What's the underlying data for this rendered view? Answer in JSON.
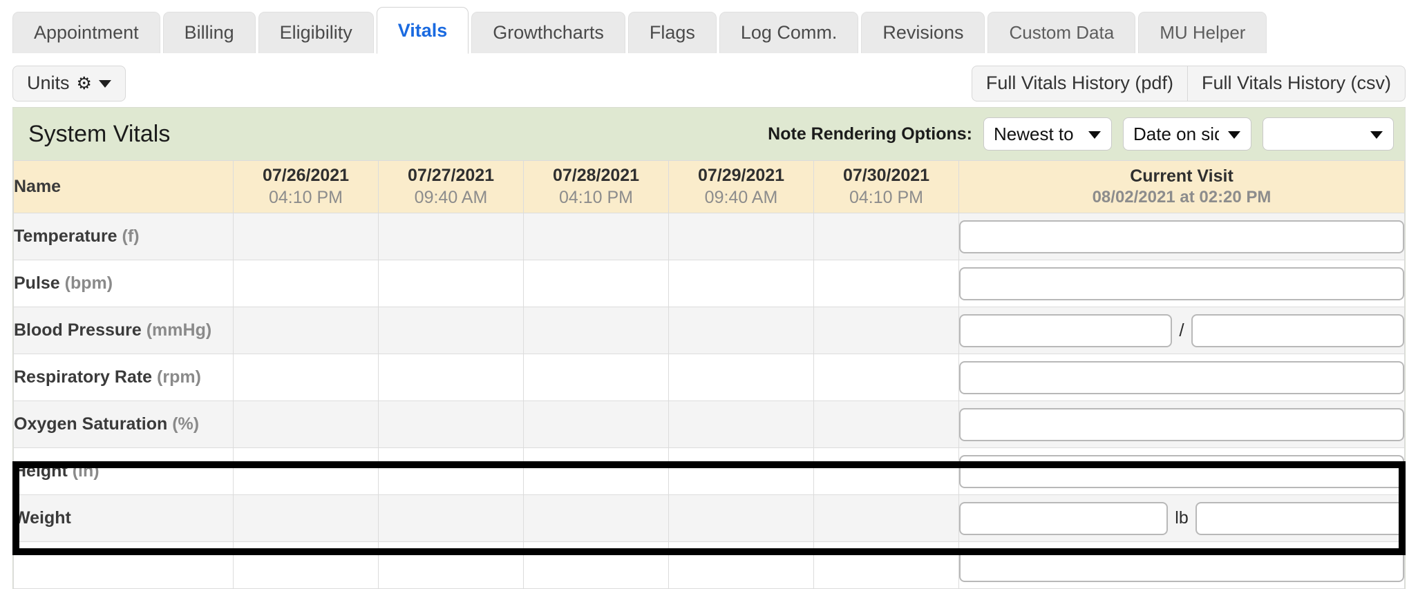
{
  "tabs": [
    {
      "label": "Appointment",
      "active": false,
      "muted": false
    },
    {
      "label": "Billing",
      "active": false,
      "muted": false
    },
    {
      "label": "Eligibility",
      "active": false,
      "muted": false
    },
    {
      "label": "Vitals",
      "active": true,
      "muted": false
    },
    {
      "label": "Growthcharts",
      "active": false,
      "muted": false
    },
    {
      "label": "Flags",
      "active": false,
      "muted": false
    },
    {
      "label": "Log Comm.",
      "active": false,
      "muted": false
    },
    {
      "label": "Revisions",
      "active": false,
      "muted": false
    },
    {
      "label": "Custom Data",
      "active": false,
      "muted": true
    },
    {
      "label": "MU Helper",
      "active": false,
      "muted": true
    }
  ],
  "toolbar": {
    "units_label": "Units",
    "gear_icon": "gear-icon",
    "caret_icon": "caret-down-icon",
    "history_pdf": "Full Vitals History (pdf)",
    "history_csv": "Full Vitals History (csv)"
  },
  "panel": {
    "title": "System Vitals",
    "note_options_label": "Note Rendering Options:",
    "sort_selected": "Newest to oldest",
    "date_selected": "Date on side",
    "blank_selected": ""
  },
  "table": {
    "name_header": "Name",
    "columns": [
      {
        "date": "07/26/2021",
        "time": "04:10 PM"
      },
      {
        "date": "07/27/2021",
        "time": "09:40 AM"
      },
      {
        "date": "07/28/2021",
        "time": "04:10 PM"
      },
      {
        "date": "07/29/2021",
        "time": "09:40 AM"
      },
      {
        "date": "07/30/2021",
        "time": "04:10 PM"
      }
    ],
    "current_visit": {
      "label": "Current Visit",
      "sub": "08/02/2021 at 02:20 PM"
    },
    "rows": [
      {
        "name": "Temperature",
        "unit": "(f)",
        "values": [
          "",
          "",
          "",
          "",
          ""
        ],
        "input": "single",
        "current": ""
      },
      {
        "name": "Pulse",
        "unit": "(bpm)",
        "values": [
          "",
          "",
          "",
          "",
          ""
        ],
        "input": "single",
        "current": ""
      },
      {
        "name": "Blood Pressure",
        "unit": "(mmHg)",
        "values": [
          "",
          "",
          "",
          "",
          ""
        ],
        "input": "pair",
        "separator": "/",
        "current": [
          "",
          ""
        ]
      },
      {
        "name": "Respiratory Rate",
        "unit": "(rpm)",
        "values": [
          "",
          "",
          "",
          "",
          ""
        ],
        "input": "single",
        "current": ""
      },
      {
        "name": "Oxygen Saturation",
        "unit": "(%)",
        "values": [
          "",
          "",
          "",
          "",
          ""
        ],
        "input": "single",
        "current": ""
      },
      {
        "name": "Height",
        "unit": "(in)",
        "values": [
          "",
          "",
          "",
          "",
          ""
        ],
        "input": "single",
        "current": "",
        "highlighted": true
      },
      {
        "name": "Weight",
        "unit": "",
        "values": [
          "",
          "",
          "",
          "",
          ""
        ],
        "input": "pair",
        "separator": "lb",
        "current": [
          "",
          ""
        ],
        "highlighted": true
      }
    ]
  },
  "colors": {
    "active_tab_text": "#1a6ae0",
    "panel_header_bg": "#dfe8d1",
    "table_header_bg": "#faeccb",
    "row_shade_bg": "#f4f4f4",
    "highlight_border": "#000000"
  }
}
